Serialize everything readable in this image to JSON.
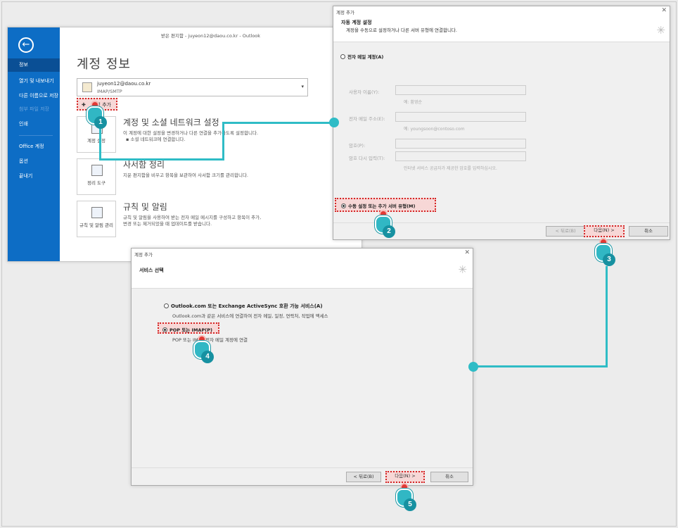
{
  "outlook": {
    "window_title": "받은 편지함 - juyeon12@daou.co.kr - Outlook",
    "nav": [
      {
        "label": "정보",
        "active": true
      },
      {
        "label": "열기 및 내보내기"
      },
      {
        "label": "다른 이름으로 저장"
      },
      {
        "label": "첨부 파일 저장",
        "disabled": true
      },
      {
        "label": "인쇄"
      },
      {
        "label": "Office 계정"
      },
      {
        "label": "옵션"
      },
      {
        "label": "끝내기"
      }
    ],
    "page_title": "계정 정보",
    "account_email": "juyeon12@daou.co.kr",
    "account_type": "IMAP/SMTP",
    "add_account_label": "계정 추가",
    "sections": [
      {
        "tile_label": "계정 설정",
        "heading": "계정 및 소셜 네트워크 설정",
        "desc1": "이 계정에 대한 설정을 변경하거나 다른 연결을 추가하도록 설정합니다.",
        "desc2": "▪ 소셜 네트워크에 연결합니다."
      },
      {
        "tile_label": "정리 도구",
        "heading": "사서함 정리",
        "desc1": "지운 편지함을 비우고 항목을 보관하여 사서함 크기를 관리합니다.",
        "desc2": ""
      },
      {
        "tile_label": "규칙 및 알림 관리",
        "heading": "규칙 및 알림",
        "desc1": "규칙 및 알림을 사용하여 받는 전자 메일 메시지를 구성하고 항목이 추가,",
        "desc2": "변경 또는 제거되었을 때 업데이트를 받습니다."
      }
    ]
  },
  "dialog1": {
    "caption": "계정 추가",
    "header_title": "자동 계정 설정",
    "header_sub": "계정을 수동으로 설정하거나 다른 서버 유형에 연결합니다.",
    "radio_email": "전자 메일 계정(A)",
    "fields": [
      {
        "label": "사용자 이름(Y):",
        "hint": "예: 황영순"
      },
      {
        "label": "전자 메일 주소(E):",
        "hint": "예: youngsoon@contoso.com"
      },
      {
        "label": "암호(P):",
        "hint": ""
      },
      {
        "label": "암호 다시 입력(T):",
        "hint": "인터넷 서비스 공급자가 제공한 암호를 입력하십시오."
      }
    ],
    "radio_manual": "수동 설정 또는 추가 서버 유형(M)",
    "back_button": "< 뒤로(B)",
    "next_button": "다음(N) >",
    "cancel_button": "취소"
  },
  "dialog2": {
    "caption": "계정 추가",
    "header_title": "서비스 선택",
    "option1_label": "Outlook.com 또는 Exchange ActiveSync 호환 가능 서비스(A)",
    "option1_desc": "Outlook.com과 같은 서비스에 연결하여 전자 메일, 일정, 연락처, 작업에 액세스",
    "option2_label": "POP 또는 IMAP(P)",
    "option2_desc": "POP 또는 IMAP 전자 메일 계정에 연결",
    "back_button": "< 뒤로(B)",
    "next_button": "다음(N) >",
    "cancel_button": "취소"
  },
  "steps": [
    "1",
    "2",
    "3",
    "4",
    "5"
  ],
  "colors": {
    "accent": "#2fbcc6",
    "highlight_border": "#d42424",
    "outlook_blue": "#0d6dc5"
  }
}
